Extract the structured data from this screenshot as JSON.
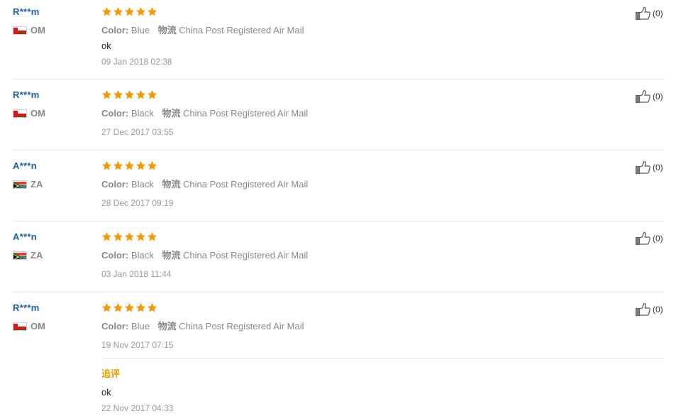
{
  "labels": {
    "color": "Color:",
    "logistics": "物流",
    "additional_feedback": "追评"
  },
  "feedbacks": [
    {
      "user": "R***m",
      "country": "OM",
      "rating": 5,
      "color": "Blue",
      "logistics": "China Post Registered Air Mail",
      "text": "ok",
      "date": "09 Jan 2018 02:38",
      "helpful": "(0)"
    },
    {
      "user": "R***m",
      "country": "OM",
      "rating": 5,
      "color": "Black",
      "logistics": "China Post Registered Air Mail",
      "text": "",
      "date": "27 Dec 2017 03:55",
      "helpful": "(0)"
    },
    {
      "user": "A***n",
      "country": "ZA",
      "rating": 5,
      "color": "Black",
      "logistics": "China Post Registered Air Mail",
      "text": "",
      "date": "28 Dec 2017 09:19",
      "helpful": "(0)"
    },
    {
      "user": "A***n",
      "country": "ZA",
      "rating": 5,
      "color": "Black",
      "logistics": "China Post Registered Air Mail",
      "text": "",
      "date": "03 Jan 2018 11:44",
      "helpful": "(0)"
    },
    {
      "user": "R***m",
      "country": "OM",
      "rating": 5,
      "color": "Blue",
      "logistics": "China Post Registered Air Mail",
      "text": "",
      "date": "19 Nov 2017 07:15",
      "helpful": "(0)",
      "additional": {
        "text": "ok",
        "date": "22 Nov 2017 04:33"
      }
    }
  ],
  "colors": {
    "user_link": "#1a5fa8",
    "star": "#f39800",
    "additional_title": "#f0a000"
  },
  "icons": {
    "rating": "star-icon",
    "helpful": "thumbs-up-icon",
    "country": "flag-icon"
  }
}
